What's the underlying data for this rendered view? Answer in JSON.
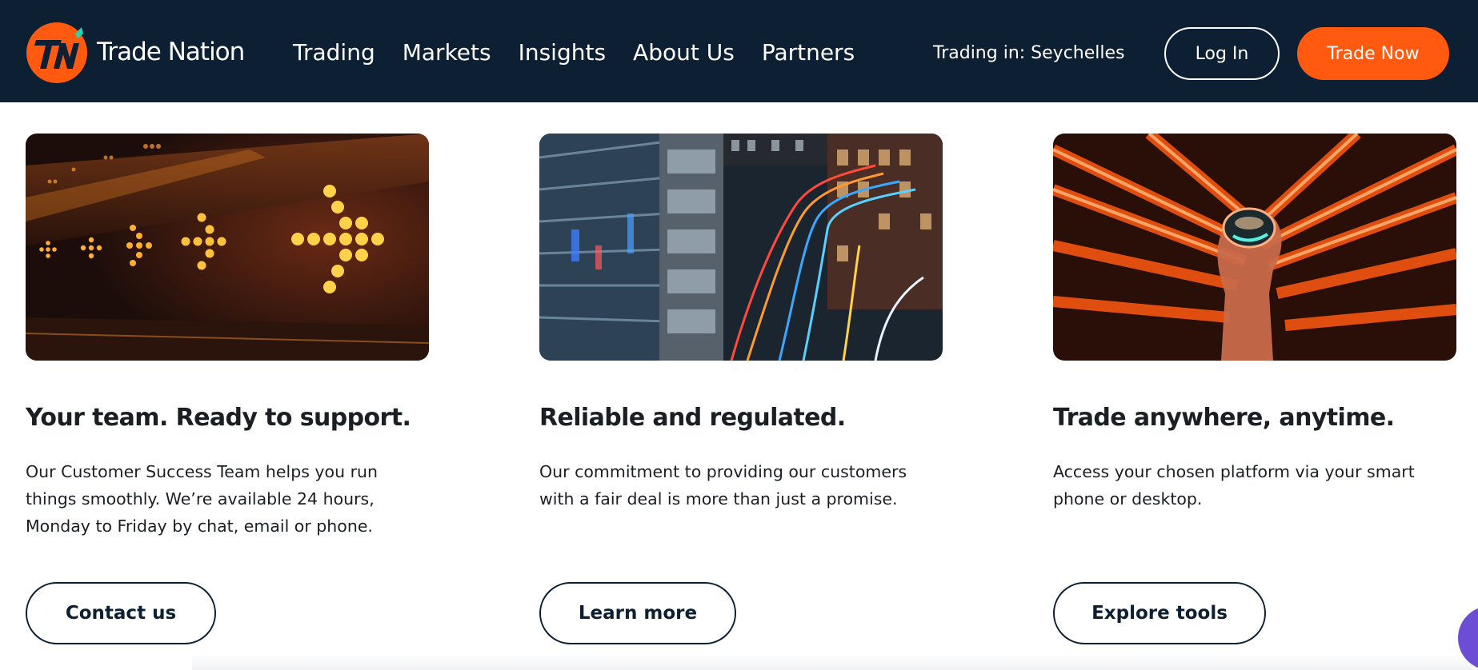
{
  "header": {
    "logo_text": "Trade Nation",
    "nav": [
      {
        "label": "Trading"
      },
      {
        "label": "Markets"
      },
      {
        "label": "Insights"
      },
      {
        "label": "About Us"
      },
      {
        "label": "Partners"
      }
    ],
    "trading_in": "Trading in: Seychelles",
    "login_label": "Log In",
    "trade_now_label": "Trade Now"
  },
  "cards": [
    {
      "image": "led-arrows-image",
      "title": "Your team. Ready to support.",
      "body": "Our Customer Success Team helps you run things smoothly. We’re available 24 hours, Monday to Friday by chat, email or phone.",
      "button": "Contact us"
    },
    {
      "image": "city-light-trails-image",
      "title": "Reliable and regulated.",
      "body": "Our commitment to providing our customers with a fair deal is more than just a promise.",
      "button": "Learn more"
    },
    {
      "image": "neon-hand-image",
      "title": "Trade anywhere, anytime.",
      "body": "Access your chosen platform via your smart phone or desktop.",
      "button": "Explore tools"
    }
  ],
  "colors": {
    "header_bg": "#0c1f33",
    "accent": "#ff5a10",
    "text_dark": "#1b1f24",
    "chat_widget": "#6b4dd6"
  }
}
